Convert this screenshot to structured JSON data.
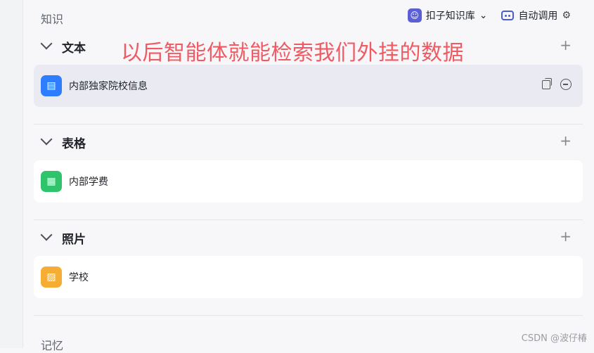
{
  "header": {
    "title": "知识",
    "kb_label": "扣子知识库",
    "kb_avatar_glyph": "☺",
    "auto_call_label": "自动调用"
  },
  "annotation": "以后智能体就能检索我们外挂的数据",
  "sections": [
    {
      "label": "文本",
      "item": {
        "label": "内部独家院校信息",
        "icon": "doc-icon",
        "color": "#3b82f6"
      }
    },
    {
      "label": "表格",
      "item": {
        "label": "内部学费",
        "icon": "table-icon",
        "color": "#22c55e"
      }
    },
    {
      "label": "照片",
      "item": {
        "label": "学校",
        "icon": "image-icon",
        "color": "#f5a623"
      }
    }
  ],
  "memory_title": "记忆",
  "watermark": "CSDN @波仔椿"
}
